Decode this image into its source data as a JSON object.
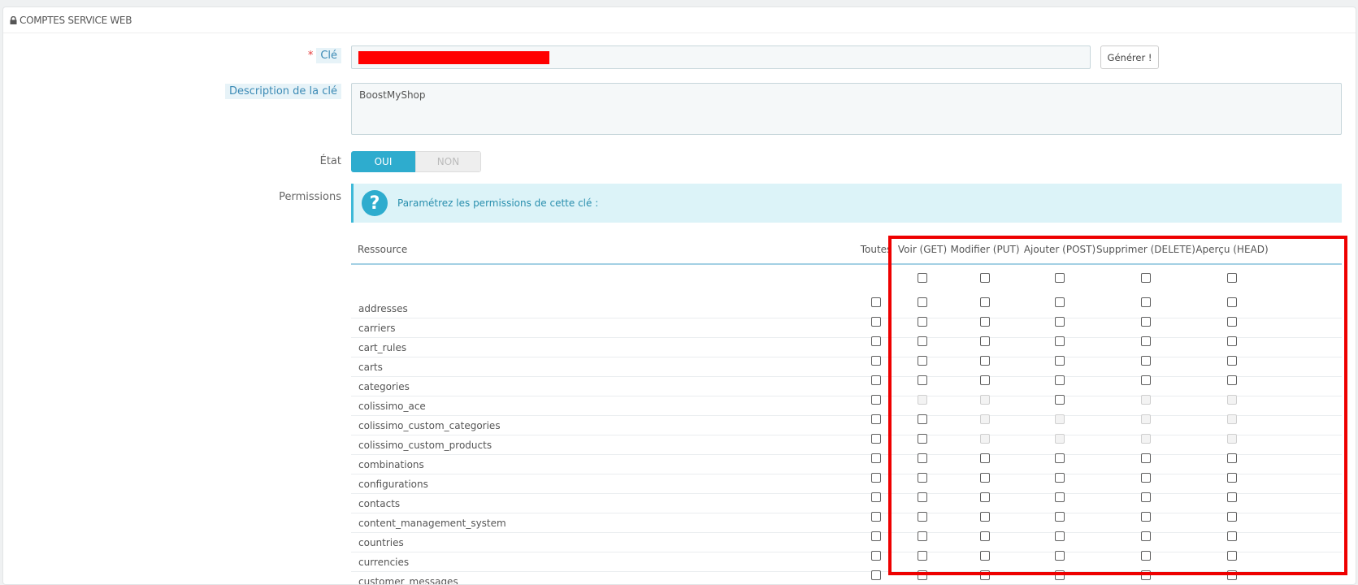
{
  "panel": {
    "title": "Comptes service web"
  },
  "form": {
    "key_label": "Clé",
    "key_required_marker": "*",
    "generate_button": "Générer !",
    "description_label": "Description de la clé",
    "description_value": "BoostMyShop",
    "state_label": "État",
    "state_on_label": "OUI",
    "state_off_label": "NON",
    "state_selected": "OUI",
    "permissions_label": "Permissions",
    "permissions_info": "Paramétrez les permissions de cette clé :"
  },
  "table": {
    "resource_header": "Ressource",
    "columns": [
      "Toutes",
      "Voir (GET)",
      "Modifier (PUT)",
      "Ajouter (POST)",
      "Supprimer (DELETE)",
      "Aperçu (HEAD)"
    ],
    "rows": [
      {
        "name": "addresses",
        "disabled": [
          false,
          false,
          false,
          false,
          false,
          false
        ]
      },
      {
        "name": "carriers",
        "disabled": [
          false,
          false,
          false,
          false,
          false,
          false
        ]
      },
      {
        "name": "cart_rules",
        "disabled": [
          false,
          false,
          false,
          false,
          false,
          false
        ]
      },
      {
        "name": "carts",
        "disabled": [
          false,
          false,
          false,
          false,
          false,
          false
        ]
      },
      {
        "name": "categories",
        "disabled": [
          false,
          false,
          false,
          false,
          false,
          false
        ]
      },
      {
        "name": "colissimo_ace",
        "disabled": [
          false,
          true,
          true,
          false,
          true,
          true
        ]
      },
      {
        "name": "colissimo_custom_categories",
        "disabled": [
          false,
          false,
          true,
          true,
          true,
          true
        ]
      },
      {
        "name": "colissimo_custom_products",
        "disabled": [
          false,
          false,
          true,
          true,
          true,
          true
        ]
      },
      {
        "name": "combinations",
        "disabled": [
          false,
          false,
          false,
          false,
          false,
          false
        ]
      },
      {
        "name": "configurations",
        "disabled": [
          false,
          false,
          false,
          false,
          false,
          false
        ]
      },
      {
        "name": "contacts",
        "disabled": [
          false,
          false,
          false,
          false,
          false,
          false
        ]
      },
      {
        "name": "content_management_system",
        "disabled": [
          false,
          false,
          false,
          false,
          false,
          false
        ]
      },
      {
        "name": "countries",
        "disabled": [
          false,
          false,
          false,
          false,
          false,
          false
        ]
      },
      {
        "name": "currencies",
        "disabled": [
          false,
          false,
          false,
          false,
          false,
          false
        ]
      },
      {
        "name": "customer_messages",
        "disabled": [
          false,
          false,
          false,
          false,
          false,
          false
        ]
      }
    ]
  },
  "colors": {
    "accent": "#2eacce",
    "highlight": "#ee0000",
    "redaction": "#ff0000"
  },
  "icons": {
    "panel_icon": "lock-icon",
    "info_icon": "question-icon"
  }
}
